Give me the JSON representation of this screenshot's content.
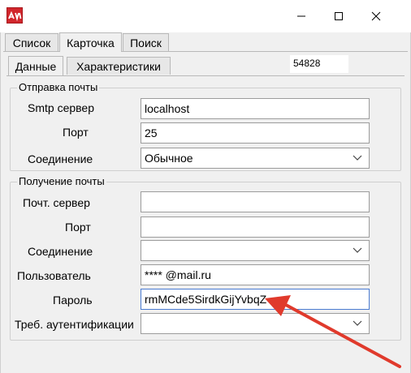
{
  "window": {
    "logo_icon": "app-logo-icon",
    "min_icon": "minimize-icon",
    "max_icon": "maximize-icon",
    "close_icon": "close-icon"
  },
  "tabs": [
    {
      "label": "Список",
      "active": false
    },
    {
      "label": "Карточка",
      "active": true
    },
    {
      "label": "Поиск",
      "active": false
    }
  ],
  "subtabs": [
    {
      "label": "Данные",
      "active": true
    },
    {
      "label": "Характеристики",
      "active": false
    }
  ],
  "record_id": "54828",
  "outgoing": {
    "title": "Отправка почты",
    "smtp_label": "Smtp сервер",
    "smtp_value": "localhost",
    "port_label": "Порт",
    "port_value": "25",
    "conn_label": "Соединение",
    "conn_value": "Обычное"
  },
  "incoming": {
    "title": "Получение почты",
    "server_label": "Почт. сервер",
    "server_value": "",
    "port_label": "Порт",
    "port_value": "",
    "conn_label": "Соединение",
    "conn_value": "",
    "user_label": "Пользователь",
    "user_value": "**** @mail.ru",
    "password_label": "Пароль",
    "password_value": "rmMCde5SirdkGijYvbqZ",
    "auth_label": "Треб. аутентификации",
    "auth_value": ""
  },
  "colors": {
    "annotation_arrow": "#e03a2c",
    "focus_border": "#4a7bd1",
    "logo": "#d1262c"
  }
}
